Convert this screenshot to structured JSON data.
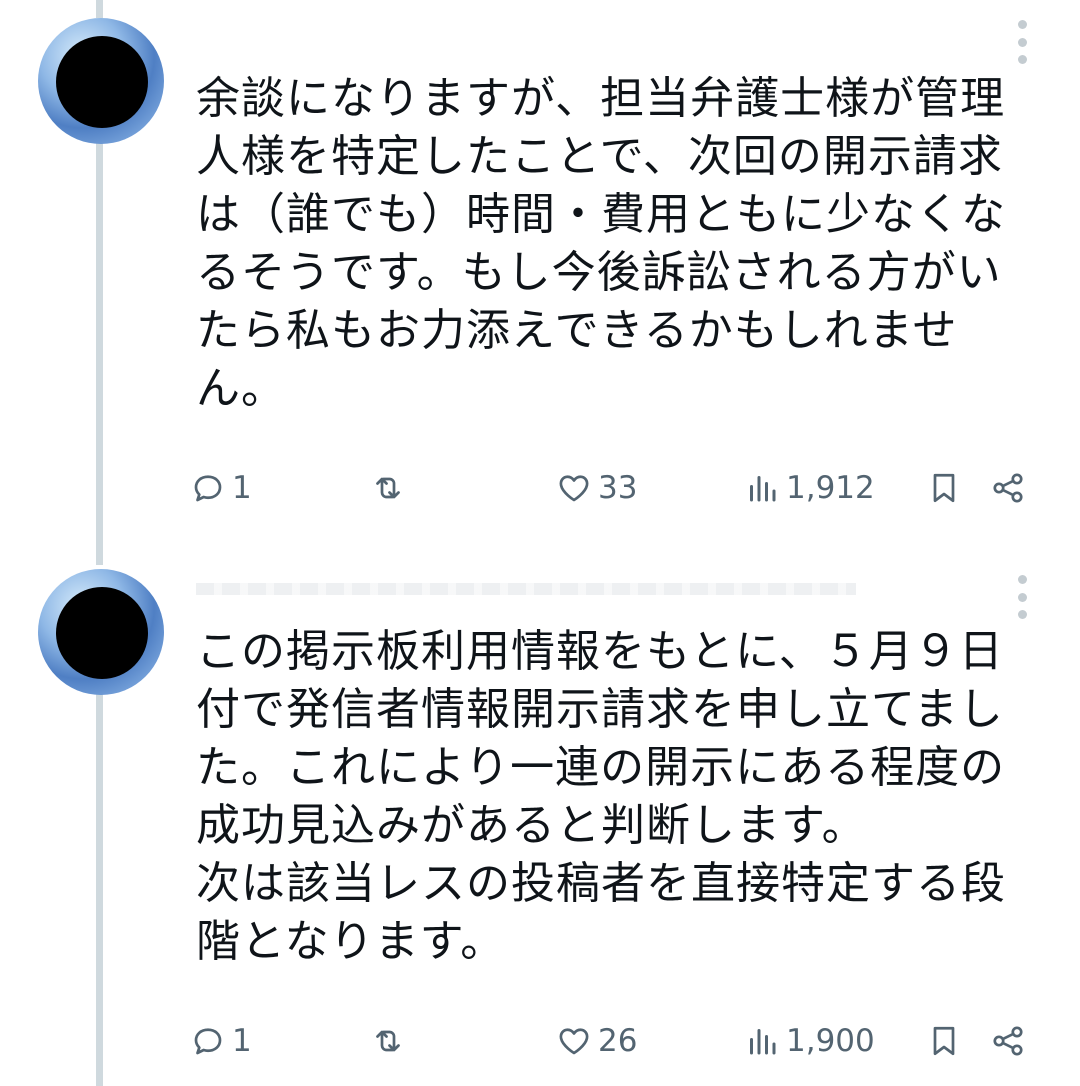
{
  "tweets": [
    {
      "text": "余談になりますが、担当弁護士様が管理人様を特定したことで、次回の開示請求は（誰でも）時間・費用ともに少なくなるそうです。もし今後訴訟される方がいたら私もお力添えできるかもしれません。",
      "reply_count": "1",
      "like_count": "33",
      "view_count": "1,912"
    },
    {
      "text": "この掲示板利用情報をもとに、５月９日付で発信者情報開示請求を申し立てました。これにより一連の開示にある程度の成功見込みがあると判断します。\n次は該当レスの投稿者を直接特定する段階となります。",
      "reply_count": "1",
      "like_count": "26",
      "view_count": "1,900"
    }
  ],
  "icons": {
    "reply": "reply-icon",
    "retweet": "retweet-icon",
    "like": "heart-icon",
    "views": "views-icon",
    "bookmark": "bookmark-icon",
    "share": "share-icon",
    "more": "more-options-icon"
  }
}
